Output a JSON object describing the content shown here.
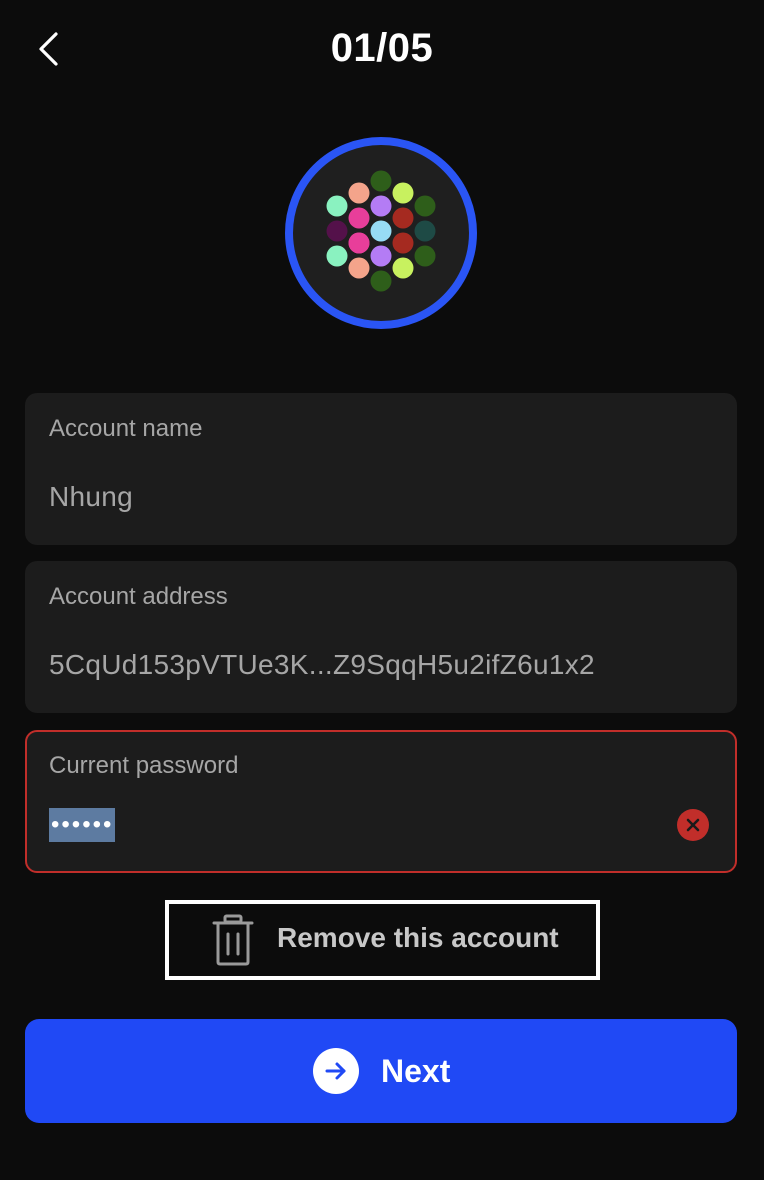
{
  "header": {
    "title": "01/05",
    "back_icon": "chevron-left-icon"
  },
  "avatar": {
    "ring_color": "#2a55f5",
    "dot_colors": [
      "#f4a48b",
      "#2e5e1a",
      "#c8f15f",
      "#8af2c0",
      "#e83e9a",
      "#b47cf5",
      "#a52a20",
      "#2e5e1a",
      "#54114a",
      "#e83e9a",
      "#97dcf5",
      "#a52a20",
      "#1e4a45",
      "#8af2c0",
      "#e83e9a",
      "#b47cf5",
      "#2e5e1a",
      "#f4a48b",
      "#c8f15f",
      "#2e5e1a"
    ]
  },
  "account_name": {
    "label": "Account name",
    "value": "Nhung"
  },
  "account_address": {
    "label": "Account address",
    "value": "5CqUd153pVTUe3K...Z9SqqH5u2ifZ6u1x2"
  },
  "current_password": {
    "label": "Current password",
    "value": "••••••",
    "state": "error",
    "clear_icon": "close-circle-icon",
    "error_color": "#c12e2a"
  },
  "remove_account": {
    "label": "Remove this account",
    "icon": "trash-icon"
  },
  "next_button": {
    "label": "Next",
    "icon": "arrow-right-circle-icon",
    "color": "#2049f5"
  }
}
